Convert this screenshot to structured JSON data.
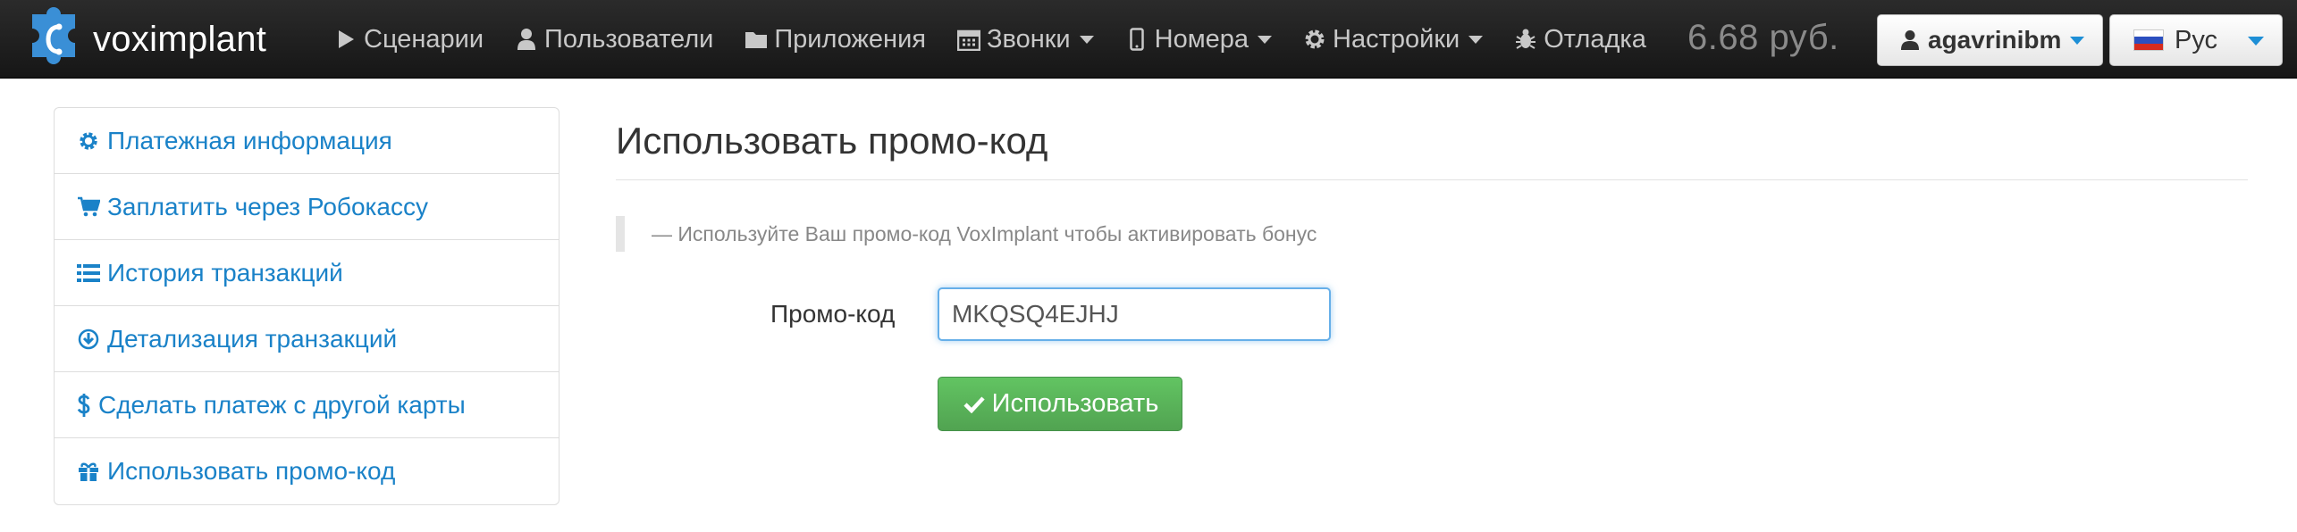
{
  "brand": {
    "name": "voximplant"
  },
  "nav": {
    "items": [
      {
        "label": "Сценарии",
        "icon": "play-icon"
      },
      {
        "label": "Пользователи",
        "icon": "user-icon"
      },
      {
        "label": "Приложения",
        "icon": "folder-icon"
      },
      {
        "label": "Звонки",
        "icon": "calendar-icon",
        "dropdown": true
      },
      {
        "label": "Номера",
        "icon": "mobile-icon",
        "dropdown": true
      },
      {
        "label": "Настройки",
        "icon": "gear-icon",
        "dropdown": true
      },
      {
        "label": "Отладка",
        "icon": "bug-icon"
      }
    ],
    "balance": "6.68 руб.",
    "user": "agavrinibm",
    "language": "Рус"
  },
  "sidebar": {
    "items": [
      {
        "label": "Платежная информация",
        "icon": "gear-icon"
      },
      {
        "label": "Заплатить через Робокассу",
        "icon": "cart-icon"
      },
      {
        "label": "История транзакций",
        "icon": "list-icon"
      },
      {
        "label": "Детализация транзакций",
        "icon": "download-icon"
      },
      {
        "label": "Сделать платеж с другой карты",
        "icon": "dollar-icon"
      },
      {
        "label": "Использовать промо-код",
        "icon": "gift-icon"
      }
    ]
  },
  "main": {
    "title": "Использовать промо-код",
    "hint": "— Используйте Ваш промо-код VoxImplant чтобы активировать бонус",
    "promo_label": "Промо-код",
    "promo_value": "MKQSQ4EJHJ",
    "submit_label": "Использовать"
  },
  "colors": {
    "navbar": "#1e1e1e",
    "link": "#1a82c8",
    "success": "#5bb75b",
    "brand_blue": "#2f79c0"
  }
}
